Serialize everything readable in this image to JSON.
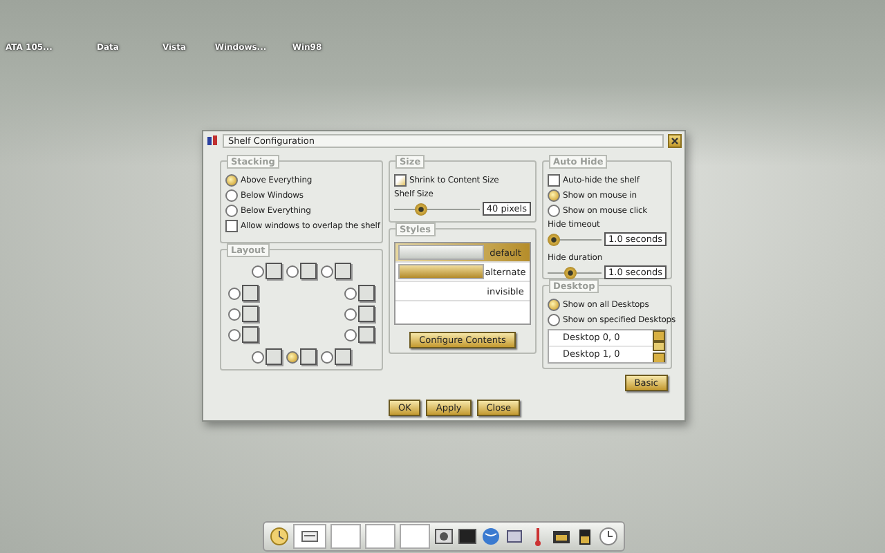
{
  "desktop_icons": [
    {
      "label": "ATA 105..."
    },
    {
      "label": "Data"
    },
    {
      "label": "Vista"
    },
    {
      "label": "Windows..."
    },
    {
      "label": "Win98"
    }
  ],
  "dialog": {
    "title": "Shelf Configuration",
    "stacking": {
      "title": "Stacking",
      "options": [
        {
          "label": "Above Everything",
          "selected": true
        },
        {
          "label": "Below Windows",
          "selected": false
        },
        {
          "label": "Below Everything",
          "selected": false
        }
      ],
      "overlap": {
        "label": "Allow windows to overlap the shelf",
        "checked": false
      }
    },
    "layout": {
      "title": "Layout",
      "top": [
        {
          "selected": false
        },
        {
          "selected": false
        },
        {
          "selected": false
        }
      ],
      "left": [
        {
          "selected": false
        },
        {
          "selected": false
        },
        {
          "selected": false
        }
      ],
      "right": [
        {
          "selected": false
        },
        {
          "selected": false
        },
        {
          "selected": false
        }
      ],
      "bottom": [
        {
          "selected": false
        },
        {
          "selected": true
        },
        {
          "selected": false
        }
      ]
    },
    "size": {
      "title": "Size",
      "shrink": {
        "label": "Shrink to Content Size",
        "checked": true
      },
      "label": "Shelf Size",
      "level": 0.3,
      "value": "40 pixels"
    },
    "styles": {
      "title": "Styles",
      "items": [
        {
          "label": "default",
          "selected": true,
          "kind": "light"
        },
        {
          "label": "alternate",
          "selected": false,
          "kind": "gold"
        },
        {
          "label": "invisible",
          "selected": false,
          "kind": "none"
        }
      ],
      "configure_button": "Configure Contents"
    },
    "auto_hide": {
      "title": "Auto Hide",
      "autohide": {
        "label": "Auto-hide the shelf",
        "checked": false
      },
      "options": [
        {
          "label": "Show on mouse in",
          "selected": true
        },
        {
          "label": "Show on mouse click",
          "selected": false
        }
      ],
      "rows": [
        {
          "kind": "caption",
          "text": "Hide timeout"
        },
        {
          "kind": "slider",
          "level": 0.1,
          "value": "1.0 seconds"
        },
        {
          "kind": "caption",
          "text": "Hide duration"
        },
        {
          "kind": "slider",
          "level": 0.4,
          "value": "1.0 seconds"
        }
      ]
    },
    "desktop": {
      "title": "Desktop",
      "options": [
        {
          "label": "Show on all Desktops",
          "selected": true
        },
        {
          "label": "Show on specified Desktops",
          "selected": false
        }
      ],
      "desktops": [
        {
          "label": "Desktop 0, 0"
        },
        {
          "label": "Desktop 1, 0"
        }
      ]
    },
    "basic_button": "Basic",
    "buttons": [
      "OK",
      "Apply",
      "Close"
    ]
  }
}
